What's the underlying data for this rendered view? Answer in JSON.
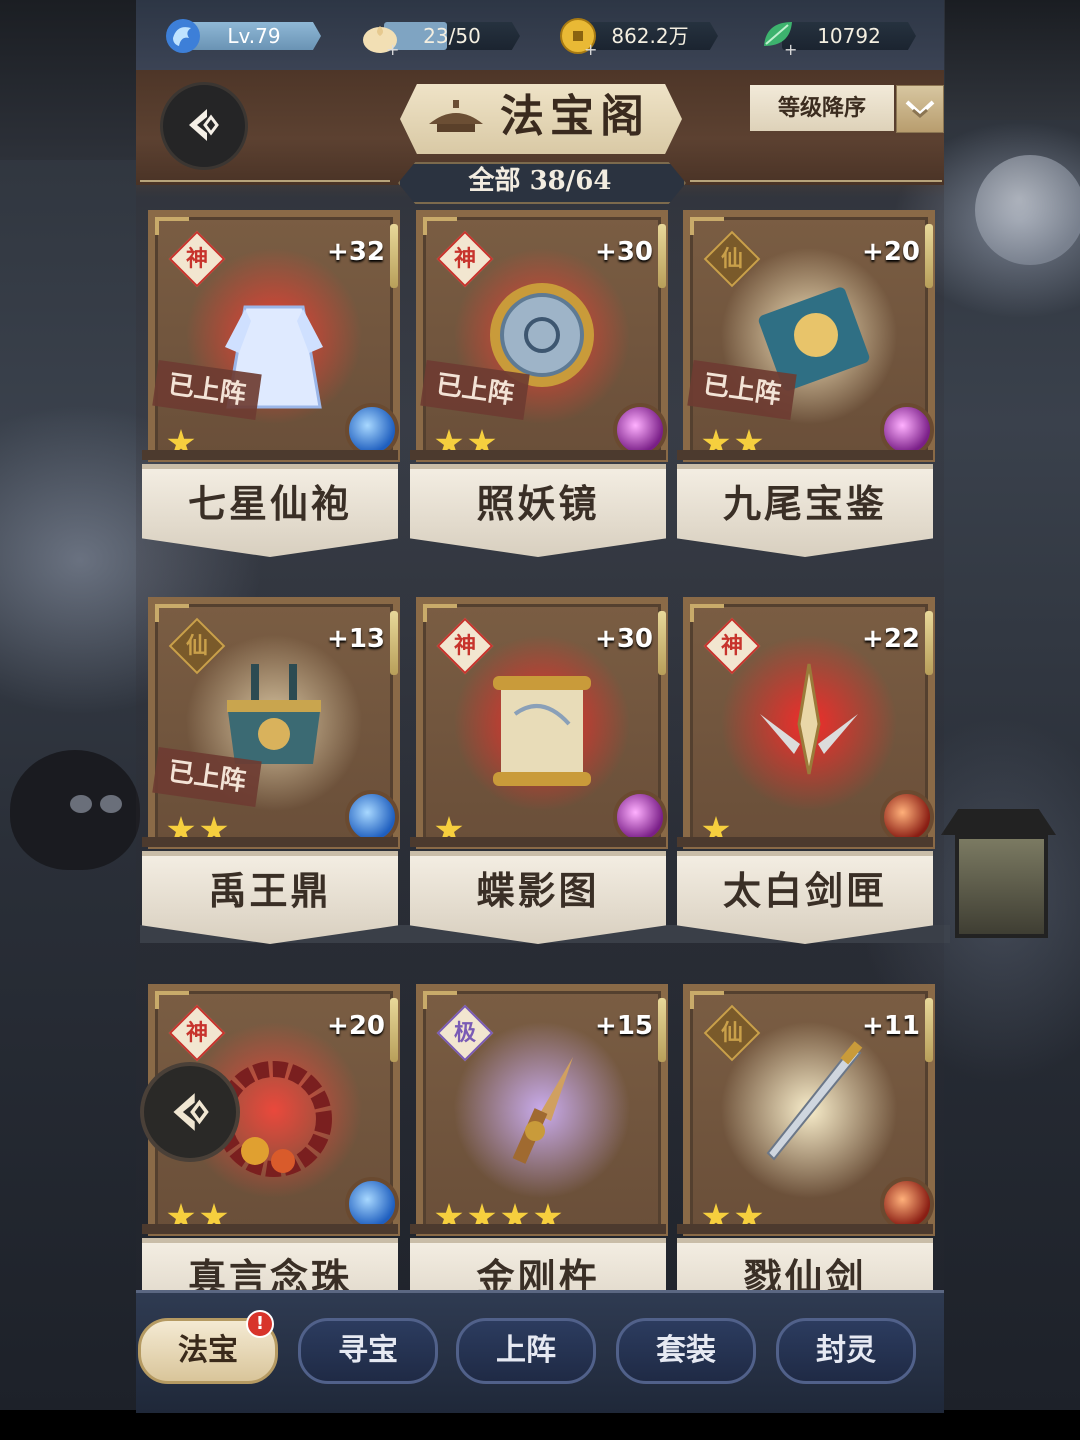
{
  "resources": {
    "level": "Lv.79",
    "stamina": "23/50",
    "stamina_fraction": 0.46,
    "coins": "862.2万",
    "jade": "10792"
  },
  "header": {
    "title": "法宝阁",
    "sort_label": "等级降序",
    "count_text": "全部 38/64"
  },
  "items": [
    {
      "name": "七星仙袍",
      "level": "+32",
      "grade": "神",
      "deployed": "已上阵",
      "stars": 1,
      "element": "water"
    },
    {
      "name": "照妖镜",
      "level": "+30",
      "grade": "神",
      "deployed": "已上阵",
      "stars": 2,
      "element": "shadow"
    },
    {
      "name": "九尾宝鉴",
      "level": "+20",
      "grade": "仙",
      "deployed": "已上阵",
      "stars": 2,
      "element": "shadow"
    },
    {
      "name": "禹王鼎",
      "level": "+13",
      "grade": "仙",
      "deployed": "已上阵",
      "stars": 2,
      "element": "water"
    },
    {
      "name": "蝶影图",
      "level": "+30",
      "grade": "神",
      "deployed": "",
      "stars": 1,
      "element": "shadow"
    },
    {
      "name": "太白剑匣",
      "level": "+22",
      "grade": "神",
      "deployed": "",
      "stars": 1,
      "element": "fire"
    },
    {
      "name": "真言念珠",
      "level": "+20",
      "grade": "神",
      "deployed": "",
      "stars": 2,
      "element": "water"
    },
    {
      "name": "金刚杵",
      "level": "+15",
      "grade": "极",
      "deployed": "",
      "stars": 4,
      "element": "none"
    },
    {
      "name": "戮仙剑",
      "level": "+11",
      "grade": "仙",
      "deployed": "",
      "stars": 2,
      "element": "fire"
    }
  ],
  "nav": {
    "tabs": [
      "法宝",
      "寻宝",
      "上阵",
      "套装",
      "封灵"
    ],
    "active": "法宝",
    "badge": "!"
  },
  "colors": {
    "grade_shen": "#c7332c",
    "grade_xian": "#c9a04a",
    "grade_ji": "#7a5bb5",
    "star": "#f6cf3e"
  }
}
